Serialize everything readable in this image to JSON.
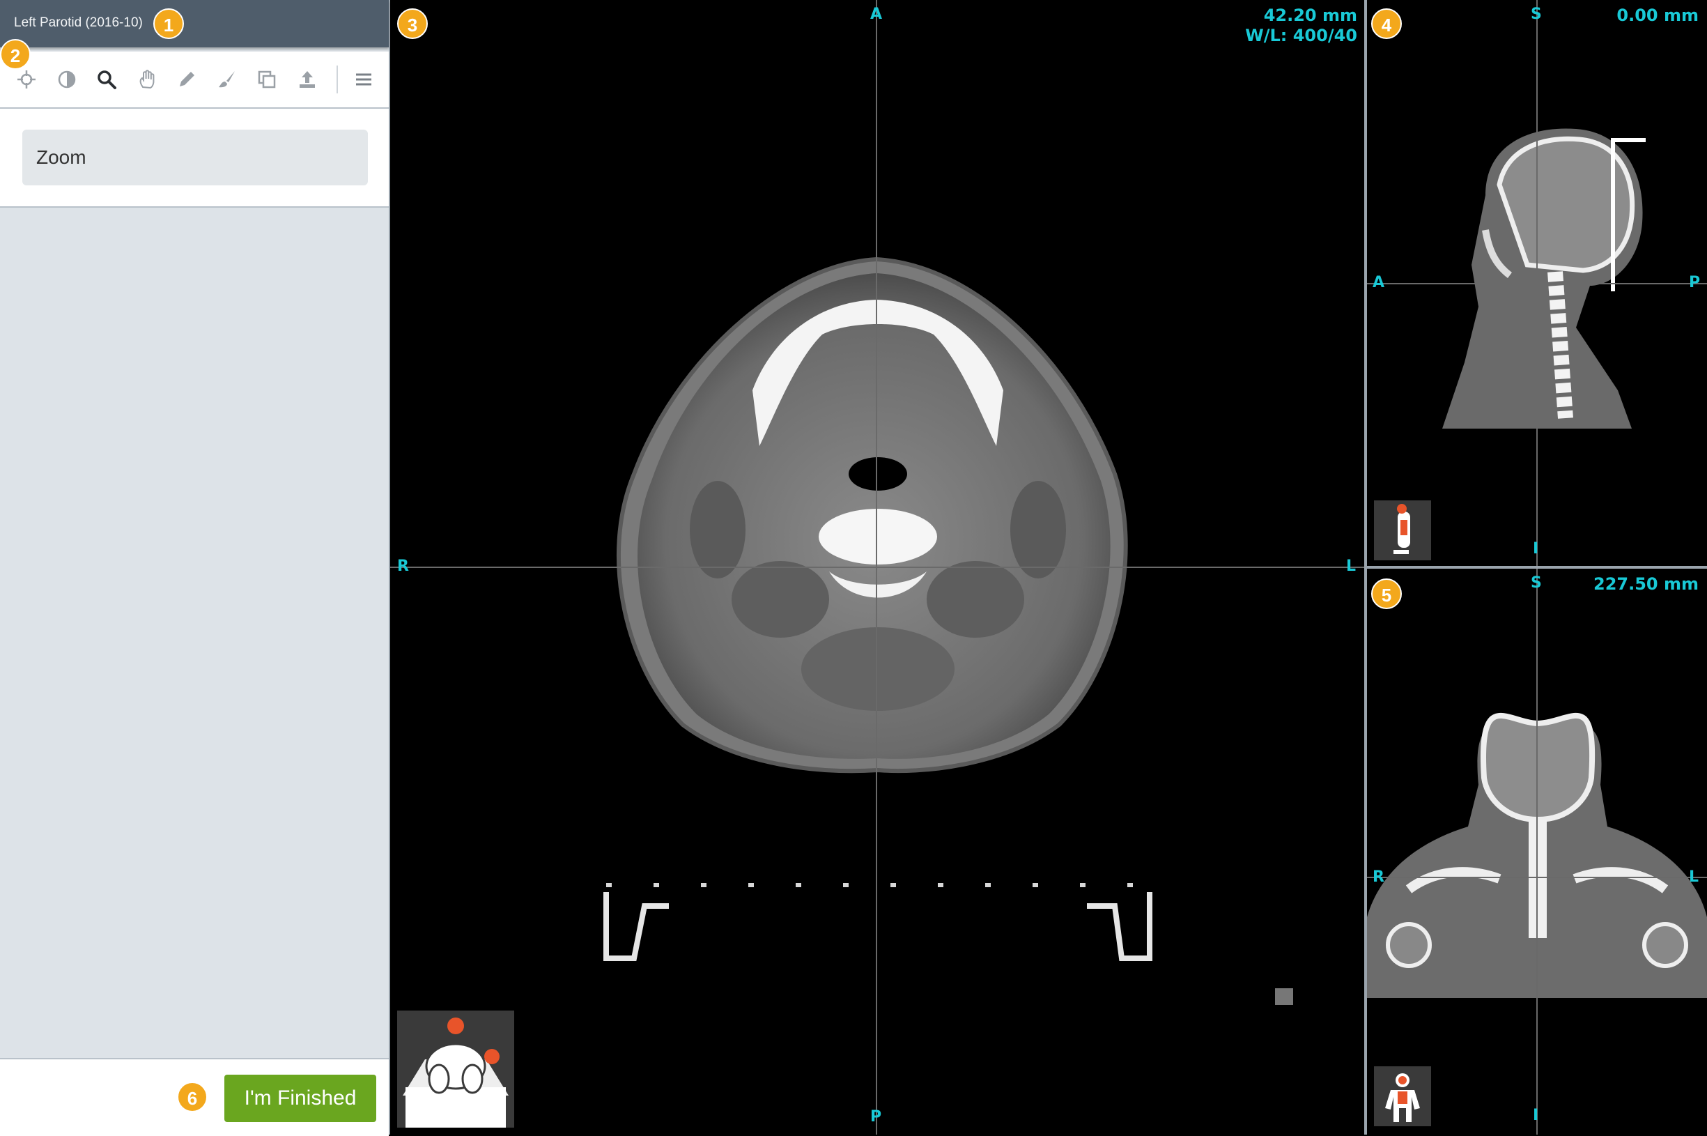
{
  "header": {
    "title": "Left Parotid (2016-10)"
  },
  "badges": [
    "1",
    "2",
    "3",
    "4",
    "5",
    "6"
  ],
  "toolbar": {
    "tools": [
      {
        "icon": "crosshair-icon"
      },
      {
        "icon": "contrast-icon"
      },
      {
        "icon": "zoom-icon"
      },
      {
        "icon": "pan-hand-icon"
      },
      {
        "icon": "pencil-icon"
      },
      {
        "icon": "brush-icon"
      },
      {
        "icon": "copy-icon"
      },
      {
        "icon": "upload-icon"
      },
      {
        "icon": "menu-icon"
      }
    ]
  },
  "panel": {
    "active_tool": "Zoom"
  },
  "footer": {
    "finish_label": "I'm Finished"
  },
  "views": {
    "axial": {
      "top": "A",
      "bottom": "P",
      "left": "R",
      "right": "L",
      "position": "42.20 mm",
      "window_level": "W/L: 400/40"
    },
    "sagittal": {
      "top": "S",
      "bottom": "I",
      "left": "A",
      "right": "P",
      "position": "0.00 mm"
    },
    "coronal": {
      "top": "S",
      "bottom": "I",
      "left": "R",
      "right": "L",
      "position": "227.50 mm"
    }
  },
  "colors": {
    "accent": "#19c9d6",
    "badge": "#f3a81c",
    "finish": "#6aa61f",
    "marker": "#e8542a"
  }
}
